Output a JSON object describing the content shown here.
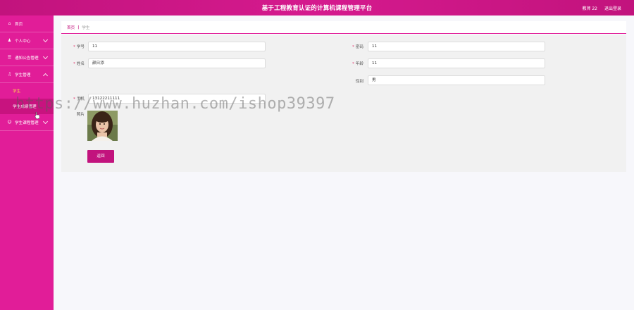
{
  "header": {
    "title": "基于工程教育认证的计算机课程管理平台",
    "user": "教师 22",
    "logout": "退出登录"
  },
  "sidebar": {
    "items": [
      {
        "label": "首页",
        "icon": "home-icon"
      },
      {
        "label": "个人中心",
        "icon": "person-icon"
      },
      {
        "label": "通知公告管理",
        "icon": "list-icon"
      },
      {
        "label": "学生管理",
        "icon": "mic-icon"
      },
      {
        "label": "学生",
        "sub": true
      },
      {
        "label": "学生成绩管理",
        "sub": true
      },
      {
        "label": "学生课程管理",
        "icon": "user-group-icon"
      }
    ]
  },
  "breadcrumb": {
    "home": "首页",
    "separator": "|",
    "current": "学生"
  },
  "form": {
    "student_id": {
      "label": "学号",
      "value": "11"
    },
    "password": {
      "label": "密码",
      "value": "11"
    },
    "name": {
      "label": "姓名",
      "value": "颜日添"
    },
    "age": {
      "label": "年龄",
      "value": "11"
    },
    "gender": {
      "label": "性别",
      "value": "男"
    },
    "phone": {
      "label": "手机",
      "value": "13122211111"
    },
    "photo": {
      "label": "照片"
    },
    "back_button": "返回"
  },
  "watermark": "https://www.huzhan.com/ishop39397",
  "colors": {
    "brand": "#e11d98",
    "header": "#c2137d",
    "active_submenu": "#ffd34d"
  }
}
